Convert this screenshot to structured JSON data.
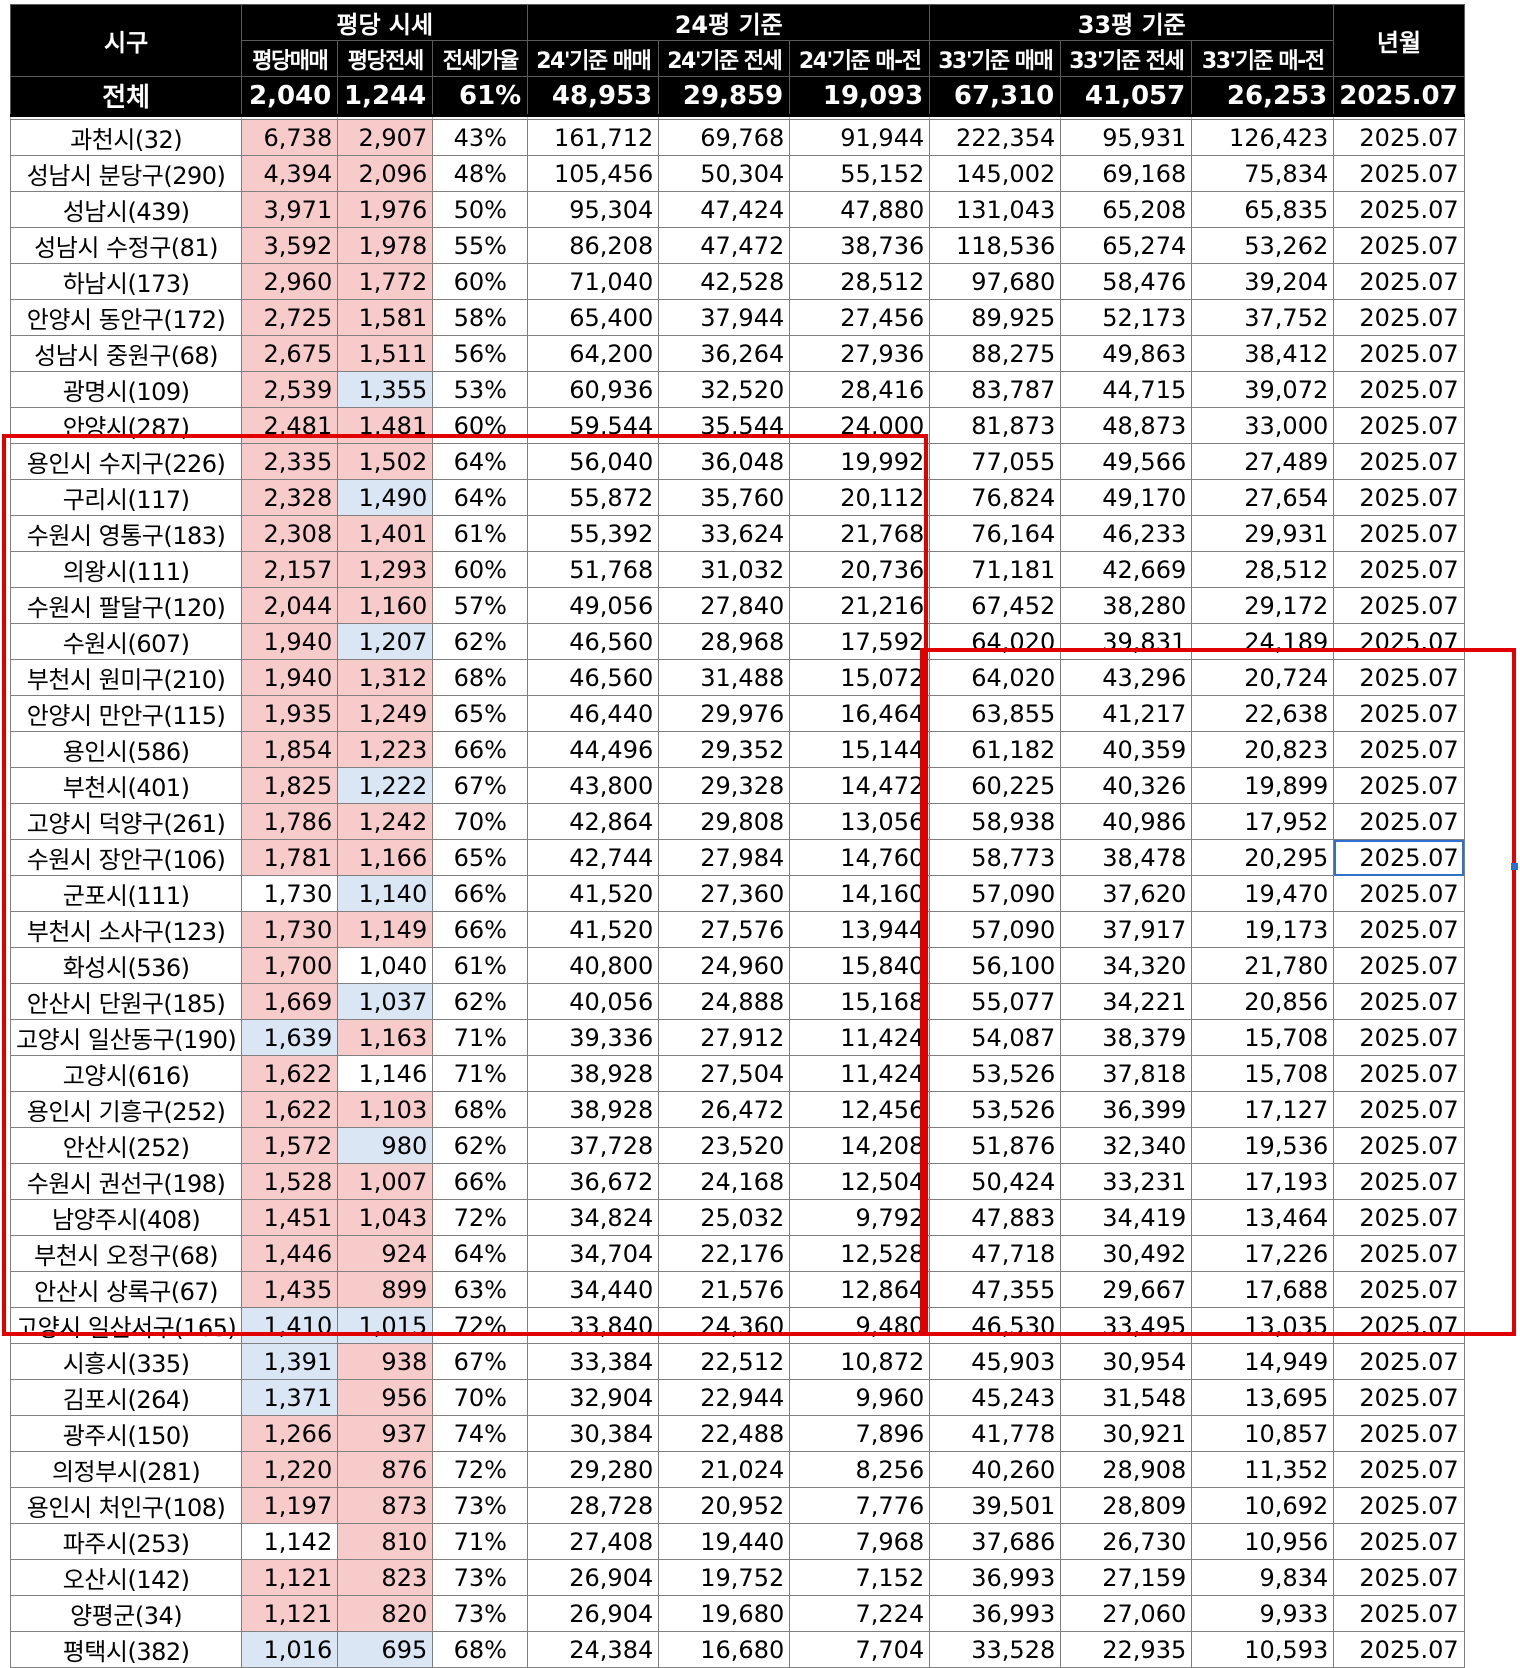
{
  "header": {
    "region_label": "시구",
    "group_pyeong_price": "평당 시세",
    "group_24": "24평 기준",
    "group_33": "33평 기준",
    "yearmonth_label": "년월",
    "sub": [
      "평당매매",
      "평당전세",
      "전세가율",
      "24'기준 매매",
      "24'기준 전세",
      "24'기준 매-전",
      "33'기준 매매",
      "33'기준 전세",
      "33'기준 매-전"
    ]
  },
  "total": {
    "label": "전체",
    "values": [
      "2,040",
      "1,244",
      "61%",
      "48,953",
      "29,859",
      "19,093",
      "67,310",
      "41,057",
      "26,253",
      "2025.07"
    ]
  },
  "rows": [
    {
      "name": "과천시(32)",
      "v": [
        "6,738",
        "2,907",
        "43%",
        "161,712",
        "69,768",
        "91,944",
        "222,354",
        "95,931",
        "126,423",
        "2025.07"
      ],
      "c1": "pink",
      "c2": "pink"
    },
    {
      "name": "성남시 분당구(290)",
      "v": [
        "4,394",
        "2,096",
        "48%",
        "105,456",
        "50,304",
        "55,152",
        "145,002",
        "69,168",
        "75,834",
        "2025.07"
      ],
      "c1": "pink",
      "c2": "pink"
    },
    {
      "name": "성남시(439)",
      "v": [
        "3,971",
        "1,976",
        "50%",
        "95,304",
        "47,424",
        "47,880",
        "131,043",
        "65,208",
        "65,835",
        "2025.07"
      ],
      "c1": "pink",
      "c2": "pink"
    },
    {
      "name": "성남시 수정구(81)",
      "v": [
        "3,592",
        "1,978",
        "55%",
        "86,208",
        "47,472",
        "38,736",
        "118,536",
        "65,274",
        "53,262",
        "2025.07"
      ],
      "c1": "pink",
      "c2": "pink"
    },
    {
      "name": "하남시(173)",
      "v": [
        "2,960",
        "1,772",
        "60%",
        "71,040",
        "42,528",
        "28,512",
        "97,680",
        "58,476",
        "39,204",
        "2025.07"
      ],
      "c1": "pink",
      "c2": "pink"
    },
    {
      "name": "안양시 동안구(172)",
      "v": [
        "2,725",
        "1,581",
        "58%",
        "65,400",
        "37,944",
        "27,456",
        "89,925",
        "52,173",
        "37,752",
        "2025.07"
      ],
      "c1": "pink",
      "c2": "pink"
    },
    {
      "name": "성남시 중원구(68)",
      "v": [
        "2,675",
        "1,511",
        "56%",
        "64,200",
        "36,264",
        "27,936",
        "88,275",
        "49,863",
        "38,412",
        "2025.07"
      ],
      "c1": "pink",
      "c2": "pink"
    },
    {
      "name": "광명시(109)",
      "v": [
        "2,539",
        "1,355",
        "53%",
        "60,936",
        "32,520",
        "28,416",
        "83,787",
        "44,715",
        "39,072",
        "2025.07"
      ],
      "c1": "pink",
      "c2": "blue"
    },
    {
      "name": "안양시(287)",
      "v": [
        "2,481",
        "1,481",
        "60%",
        "59,544",
        "35,544",
        "24,000",
        "81,873",
        "48,873",
        "33,000",
        "2025.07"
      ],
      "c1": "pink",
      "c2": "pink"
    },
    {
      "name": "용인시 수지구(226)",
      "v": [
        "2,335",
        "1,502",
        "64%",
        "56,040",
        "36,048",
        "19,992",
        "77,055",
        "49,566",
        "27,489",
        "2025.07"
      ],
      "c1": "pink",
      "c2": "pink"
    },
    {
      "name": "구리시(117)",
      "v": [
        "2,328",
        "1,490",
        "64%",
        "55,872",
        "35,760",
        "20,112",
        "76,824",
        "49,170",
        "27,654",
        "2025.07"
      ],
      "c1": "pink",
      "c2": "blue"
    },
    {
      "name": "수원시 영통구(183)",
      "v": [
        "2,308",
        "1,401",
        "61%",
        "55,392",
        "33,624",
        "21,768",
        "76,164",
        "46,233",
        "29,931",
        "2025.07"
      ],
      "c1": "pink",
      "c2": "pink"
    },
    {
      "name": "의왕시(111)",
      "v": [
        "2,157",
        "1,293",
        "60%",
        "51,768",
        "31,032",
        "20,736",
        "71,181",
        "42,669",
        "28,512",
        "2025.07"
      ],
      "c1": "pink",
      "c2": "pink"
    },
    {
      "name": "수원시 팔달구(120)",
      "v": [
        "2,044",
        "1,160",
        "57%",
        "49,056",
        "27,840",
        "21,216",
        "67,452",
        "38,280",
        "29,172",
        "2025.07"
      ],
      "c1": "pink",
      "c2": "pink"
    },
    {
      "name": "수원시(607)",
      "v": [
        "1,940",
        "1,207",
        "62%",
        "46,560",
        "28,968",
        "17,592",
        "64,020",
        "39,831",
        "24,189",
        "2025.07"
      ],
      "c1": "pink",
      "c2": "blue"
    },
    {
      "name": "부천시 원미구(210)",
      "v": [
        "1,940",
        "1,312",
        "68%",
        "46,560",
        "31,488",
        "15,072",
        "64,020",
        "43,296",
        "20,724",
        "2025.07"
      ],
      "c1": "pink",
      "c2": "pink"
    },
    {
      "name": "안양시 만안구(115)",
      "v": [
        "1,935",
        "1,249",
        "65%",
        "46,440",
        "29,976",
        "16,464",
        "63,855",
        "41,217",
        "22,638",
        "2025.07"
      ],
      "c1": "pink",
      "c2": "pink"
    },
    {
      "name": "용인시(586)",
      "v": [
        "1,854",
        "1,223",
        "66%",
        "44,496",
        "29,352",
        "15,144",
        "61,182",
        "40,359",
        "20,823",
        "2025.07"
      ],
      "c1": "pink",
      "c2": "pink"
    },
    {
      "name": "부천시(401)",
      "v": [
        "1,825",
        "1,222",
        "67%",
        "43,800",
        "29,328",
        "14,472",
        "60,225",
        "40,326",
        "19,899",
        "2025.07"
      ],
      "c1": "pink",
      "c2": "blue"
    },
    {
      "name": "고양시 덕양구(261)",
      "v": [
        "1,786",
        "1,242",
        "70%",
        "42,864",
        "29,808",
        "13,056",
        "58,938",
        "40,986",
        "17,952",
        "2025.07"
      ],
      "c1": "pink",
      "c2": "pink"
    },
    {
      "name": "수원시 장안구(106)",
      "v": [
        "1,781",
        "1,166",
        "65%",
        "42,744",
        "27,984",
        "14,760",
        "58,773",
        "38,478",
        "20,295",
        "2025.07"
      ],
      "c1": "pink",
      "c2": "pink",
      "sel": true
    },
    {
      "name": "군포시(111)",
      "v": [
        "1,730",
        "1,140",
        "66%",
        "41,520",
        "27,360",
        "14,160",
        "57,090",
        "37,620",
        "19,470",
        "2025.07"
      ],
      "c1": "",
      "c2": "blue"
    },
    {
      "name": "부천시 소사구(123)",
      "v": [
        "1,730",
        "1,149",
        "66%",
        "41,520",
        "27,576",
        "13,944",
        "57,090",
        "37,917",
        "19,173",
        "2025.07"
      ],
      "c1": "pink",
      "c2": "pink"
    },
    {
      "name": "화성시(536)",
      "v": [
        "1,700",
        "1,040",
        "61%",
        "40,800",
        "24,960",
        "15,840",
        "56,100",
        "34,320",
        "21,780",
        "2025.07"
      ],
      "c1": "pink",
      "c2": ""
    },
    {
      "name": "안산시 단원구(185)",
      "v": [
        "1,669",
        "1,037",
        "62%",
        "40,056",
        "24,888",
        "15,168",
        "55,077",
        "34,221",
        "20,856",
        "2025.07"
      ],
      "c1": "pink",
      "c2": "blue"
    },
    {
      "name": "고양시 일산동구(190)",
      "v": [
        "1,639",
        "1,163",
        "71%",
        "39,336",
        "27,912",
        "11,424",
        "54,087",
        "38,379",
        "15,708",
        "2025.07"
      ],
      "c1": "blue",
      "c2": "pink"
    },
    {
      "name": "고양시(616)",
      "v": [
        "1,622",
        "1,146",
        "71%",
        "38,928",
        "27,504",
        "11,424",
        "53,526",
        "37,818",
        "15,708",
        "2025.07"
      ],
      "c1": "pink",
      "c2": ""
    },
    {
      "name": "용인시 기흥구(252)",
      "v": [
        "1,622",
        "1,103",
        "68%",
        "38,928",
        "26,472",
        "12,456",
        "53,526",
        "36,399",
        "17,127",
        "2025.07"
      ],
      "c1": "pink",
      "c2": "pink"
    },
    {
      "name": "안산시(252)",
      "v": [
        "1,572",
        "980",
        "62%",
        "37,728",
        "23,520",
        "14,208",
        "51,876",
        "32,340",
        "19,536",
        "2025.07"
      ],
      "c1": "pink",
      "c2": "blue"
    },
    {
      "name": "수원시 권선구(198)",
      "v": [
        "1,528",
        "1,007",
        "66%",
        "36,672",
        "24,168",
        "12,504",
        "50,424",
        "33,231",
        "17,193",
        "2025.07"
      ],
      "c1": "pink",
      "c2": "pink"
    },
    {
      "name": "남양주시(408)",
      "v": [
        "1,451",
        "1,043",
        "72%",
        "34,824",
        "25,032",
        "9,792",
        "47,883",
        "34,419",
        "13,464",
        "2025.07"
      ],
      "c1": "pink",
      "c2": "pink"
    },
    {
      "name": "부천시 오정구(68)",
      "v": [
        "1,446",
        "924",
        "64%",
        "34,704",
        "22,176",
        "12,528",
        "47,718",
        "30,492",
        "17,226",
        "2025.07"
      ],
      "c1": "pink",
      "c2": "pink"
    },
    {
      "name": "안산시 상록구(67)",
      "v": [
        "1,435",
        "899",
        "63%",
        "34,440",
        "21,576",
        "12,864",
        "47,355",
        "29,667",
        "17,688",
        "2025.07"
      ],
      "c1": "pink",
      "c2": "pink"
    },
    {
      "name": "고양시 일산서구(165)",
      "v": [
        "1,410",
        "1,015",
        "72%",
        "33,840",
        "24,360",
        "9,480",
        "46,530",
        "33,495",
        "13,035",
        "2025.07"
      ],
      "c1": "blue",
      "c2": "blue"
    },
    {
      "name": "시흥시(335)",
      "v": [
        "1,391",
        "938",
        "67%",
        "33,384",
        "22,512",
        "10,872",
        "45,903",
        "30,954",
        "14,949",
        "2025.07"
      ],
      "c1": "blue",
      "c2": "pink"
    },
    {
      "name": "김포시(264)",
      "v": [
        "1,371",
        "956",
        "70%",
        "32,904",
        "22,944",
        "9,960",
        "45,243",
        "31,548",
        "13,695",
        "2025.07"
      ],
      "c1": "blue",
      "c2": "pink"
    },
    {
      "name": "광주시(150)",
      "v": [
        "1,266",
        "937",
        "74%",
        "30,384",
        "22,488",
        "7,896",
        "41,778",
        "30,921",
        "10,857",
        "2025.07"
      ],
      "c1": "pink",
      "c2": "pink"
    },
    {
      "name": "의정부시(281)",
      "v": [
        "1,220",
        "876",
        "72%",
        "29,280",
        "21,024",
        "8,256",
        "40,260",
        "28,908",
        "11,352",
        "2025.07"
      ],
      "c1": "pink",
      "c2": "pink"
    },
    {
      "name": "용인시 처인구(108)",
      "v": [
        "1,197",
        "873",
        "73%",
        "28,728",
        "20,952",
        "7,776",
        "39,501",
        "28,809",
        "10,692",
        "2025.07"
      ],
      "c1": "pink",
      "c2": "pink"
    },
    {
      "name": "파주시(253)",
      "v": [
        "1,142",
        "810",
        "71%",
        "27,408",
        "19,440",
        "7,968",
        "37,686",
        "26,730",
        "10,956",
        "2025.07"
      ],
      "c1": "",
      "c2": "pink"
    },
    {
      "name": "오산시(142)",
      "v": [
        "1,121",
        "823",
        "73%",
        "26,904",
        "19,752",
        "7,152",
        "36,993",
        "27,159",
        "9,834",
        "2025.07"
      ],
      "c1": "pink",
      "c2": "pink"
    },
    {
      "name": "양평군(34)",
      "v": [
        "1,121",
        "820",
        "73%",
        "26,904",
        "19,680",
        "7,224",
        "36,993",
        "27,060",
        "9,933",
        "2025.07"
      ],
      "c1": "pink",
      "c2": "pink"
    },
    {
      "name": "평택시(382)",
      "v": [
        "1,016",
        "695",
        "68%",
        "24,384",
        "16,680",
        "7,704",
        "33,528",
        "22,935",
        "10,593",
        "2025.07"
      ],
      "c1": "blue",
      "c2": "blue"
    }
  ],
  "colors": {
    "pink": "#f8cbcb",
    "blue": "#dae6f4",
    "highlight": "#e00000",
    "selection": "#2f6fce"
  }
}
